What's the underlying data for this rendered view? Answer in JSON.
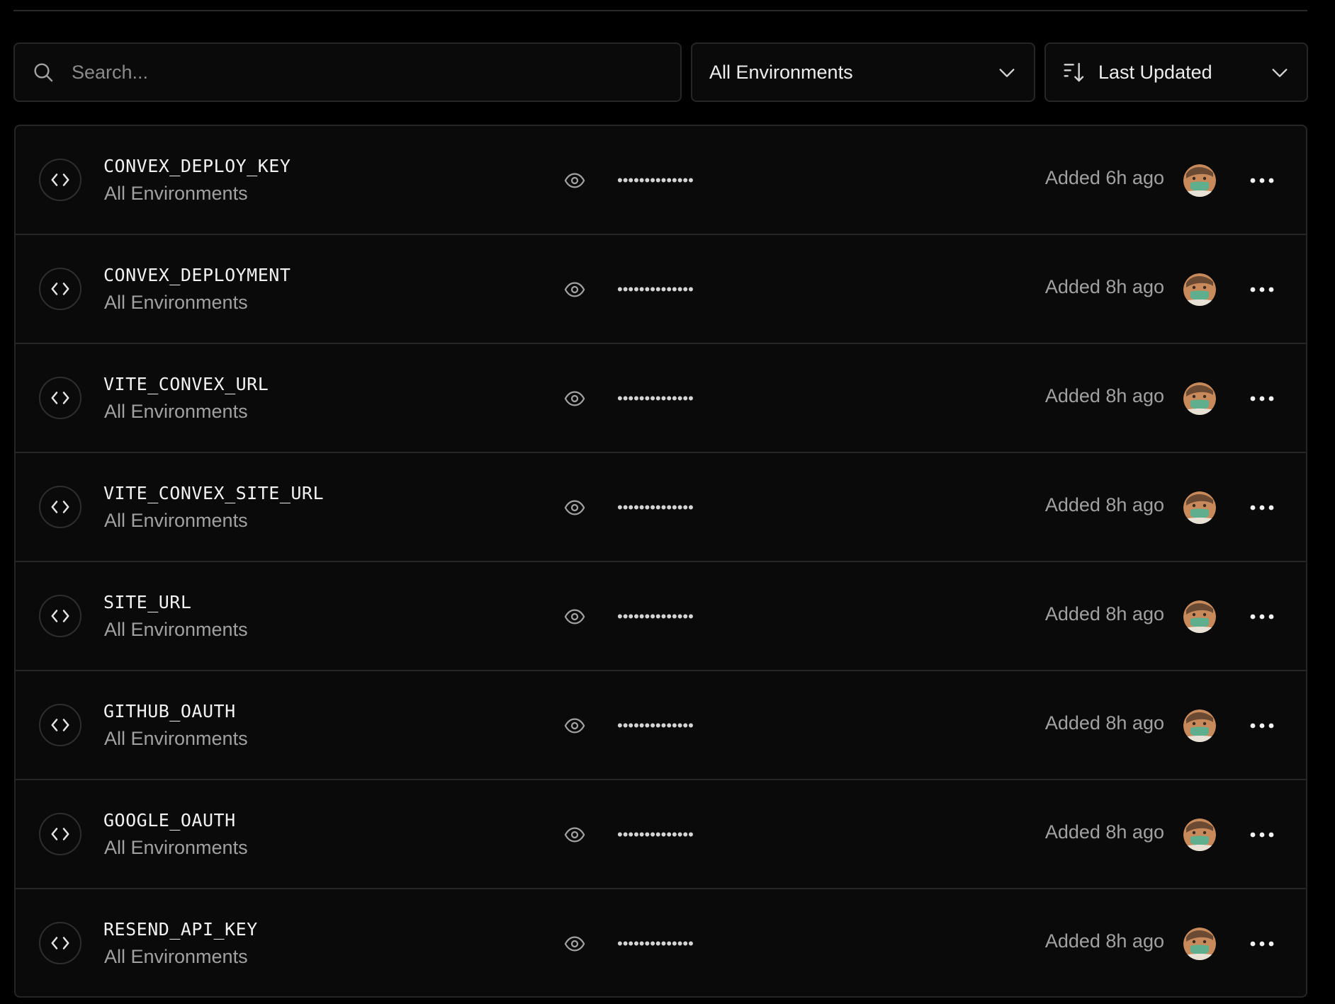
{
  "search": {
    "placeholder": "Search...",
    "value": ""
  },
  "filters": {
    "environment_label": "All Environments",
    "sort_label": "Last Updated"
  },
  "masked_value": "••••••••••••••",
  "variables": [
    {
      "name": "CONVEX_DEPLOY_KEY",
      "environment": "All Environments",
      "added": "Added 6h ago"
    },
    {
      "name": "CONVEX_DEPLOYMENT",
      "environment": "All Environments",
      "added": "Added 8h ago"
    },
    {
      "name": "VITE_CONVEX_URL",
      "environment": "All Environments",
      "added": "Added 8h ago"
    },
    {
      "name": "VITE_CONVEX_SITE_URL",
      "environment": "All Environments",
      "added": "Added 8h ago"
    },
    {
      "name": "SITE_URL",
      "environment": "All Environments",
      "added": "Added 8h ago"
    },
    {
      "name": "GITHUB_OAUTH",
      "environment": "All Environments",
      "added": "Added 8h ago"
    },
    {
      "name": "GOOGLE_OAUTH",
      "environment": "All Environments",
      "added": "Added 8h ago"
    },
    {
      "name": "RESEND_API_KEY",
      "environment": "All Environments",
      "added": "Added 8h ago"
    }
  ],
  "icons": {
    "search": "search-icon",
    "chevron": "chevron-down-icon",
    "sort": "sort-descending-icon",
    "code": "code-icon",
    "eye": "eye-icon",
    "more": "more-horizontal-icon",
    "avatar": "user-avatar"
  },
  "colors": {
    "background": "#000000",
    "panel": "#0a0a0a",
    "border": "#262626",
    "text_primary": "#ededed",
    "text_secondary": "#a1a1a1"
  }
}
